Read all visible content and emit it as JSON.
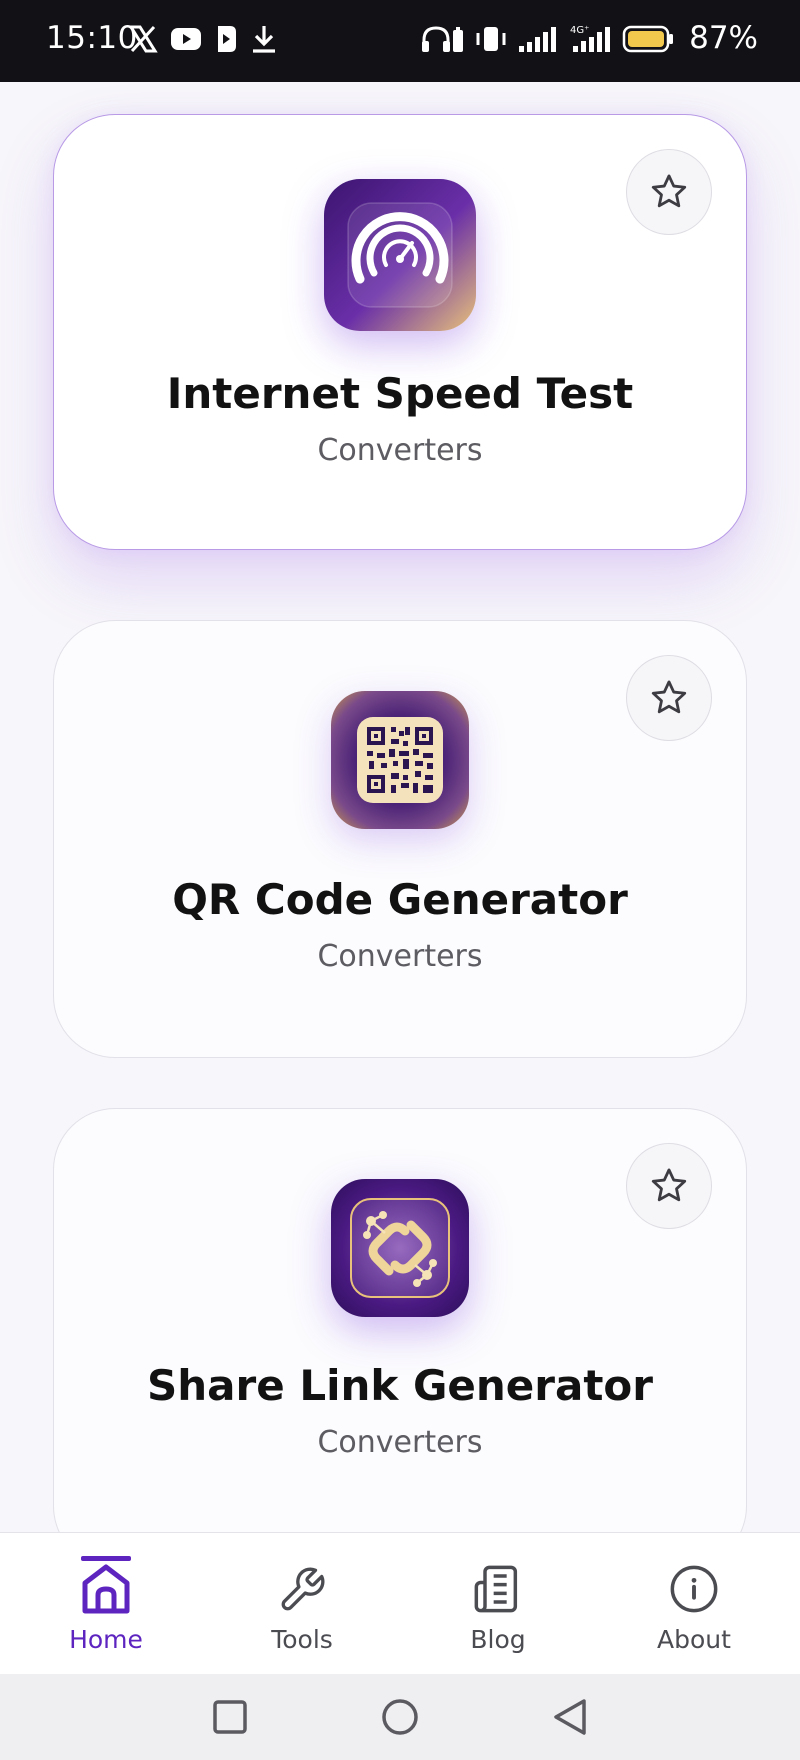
{
  "status_bar": {
    "time": "15:10",
    "battery": "87%",
    "icons_left": [
      "x-icon",
      "youtube-icon",
      "app-icon",
      "download-icon"
    ],
    "icons_right": [
      "headphones-battery-icon",
      "vibrate-icon",
      "signal-icon",
      "signal-4g-icon",
      "battery-icon"
    ],
    "network_label": "4G⁺"
  },
  "cards": [
    {
      "title": "Internet Speed Test",
      "category": "Converters",
      "icon": "speedometer-icon",
      "favorite": false,
      "active": true
    },
    {
      "title": "QR Code Generator",
      "category": "Converters",
      "icon": "qr-code-icon",
      "favorite": false,
      "active": false
    },
    {
      "title": "Share Link Generator",
      "category": "Converters",
      "icon": "link-share-icon",
      "favorite": false,
      "active": false
    }
  ],
  "bottom_nav": {
    "items": [
      {
        "label": "Home",
        "icon": "home-icon",
        "active": true
      },
      {
        "label": "Tools",
        "icon": "wrench-icon",
        "active": false
      },
      {
        "label": "Blog",
        "icon": "blog-icon",
        "active": false
      },
      {
        "label": "About",
        "icon": "info-icon",
        "active": false
      }
    ]
  },
  "colors": {
    "accent": "#5d24c0",
    "icon_purple": "#3a1570",
    "icon_gold": "#e6c27a",
    "active_border": "#b89ae6"
  }
}
